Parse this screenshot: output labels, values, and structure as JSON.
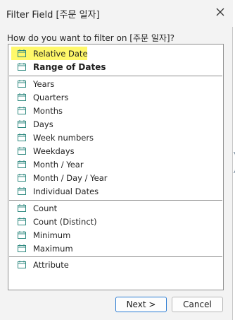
{
  "window": {
    "title": "Filter Field [주문 일자]"
  },
  "prompt": "How do you want to filter on [주문 일자]?",
  "icons": {
    "calendar": "calendar-icon",
    "close": "close-icon",
    "calendar_color": "#2f8a80",
    "highlight_color": "#fff86a"
  },
  "list": {
    "group1": [
      "Relative Date",
      "Range of Dates"
    ],
    "group2": [
      "Years",
      "Quarters",
      "Months",
      "Days",
      "Week numbers",
      "Weekdays",
      "Month / Year",
      "Month / Day / Year",
      "Individual Dates"
    ],
    "group3": [
      "Count",
      "Count (Distinct)",
      "Minimum",
      "Maximum"
    ],
    "group4": [
      "Attribute"
    ]
  },
  "buttons": {
    "next": "Next >",
    "cancel": "Cancel"
  }
}
